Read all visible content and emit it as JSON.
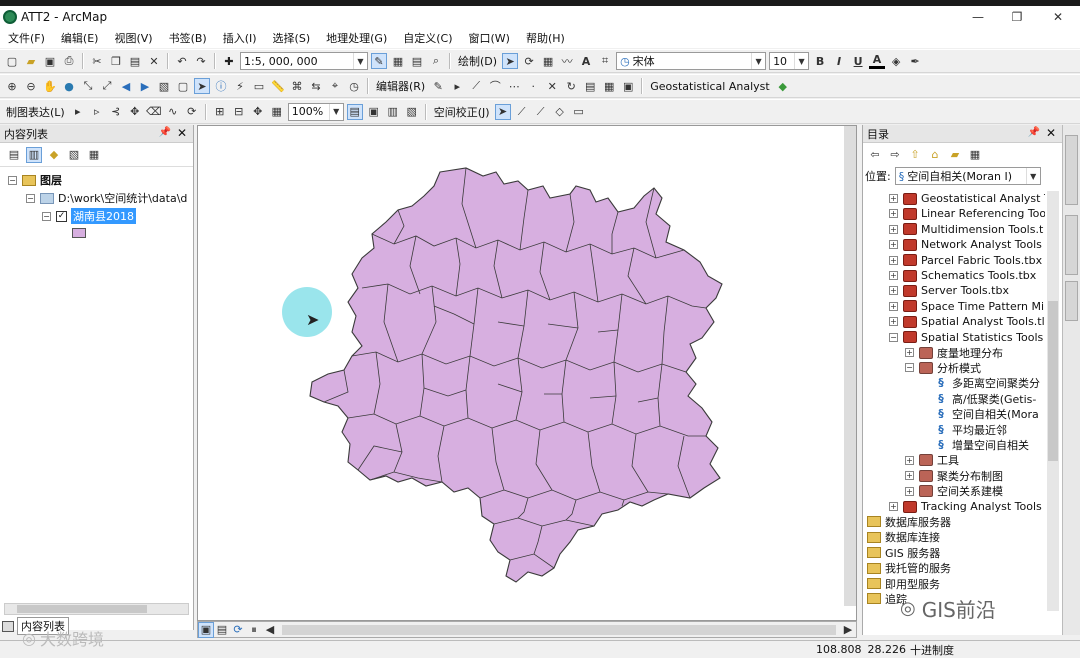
{
  "window": {
    "title": "ATT2 - ArcMap",
    "min": "—",
    "restore": "❐",
    "close": "✕"
  },
  "menus": [
    "文件(F)",
    "编辑(E)",
    "视图(V)",
    "书签(B)",
    "插入(I)",
    "选择(S)",
    "地理处理(G)",
    "自定义(C)",
    "窗口(W)",
    "帮助(H)"
  ],
  "toolbar1": {
    "scale": "1:5, 000, 000",
    "draw": "绘制(D)",
    "font": "宋体",
    "font_size": "10",
    "bold": "B",
    "italic": "I",
    "underline": "U",
    "font_color": "A"
  },
  "toolbar2": {
    "editor": "编辑器(R)",
    "geostat": "Geostatistical Analyst"
  },
  "toolbar3": {
    "layout": "制图表达(L)",
    "zoom": "100%",
    "georef": "空间校正(J)"
  },
  "toc": {
    "title": "内容列表",
    "root": "图层",
    "path": "D:\\work\\空间统计\\data\\d",
    "layer": "湖南县2018",
    "bottom_tab": "内容列表"
  },
  "catalog": {
    "title": "目录",
    "location_label": "位置:",
    "location_value": "空间自相关(Moran I)",
    "items": [
      {
        "label": "Geostatistical Analyst T",
        "kind": "tbx",
        "indent": 0,
        "expand": "+"
      },
      {
        "label": "Linear Referencing Too",
        "kind": "tbx",
        "indent": 0,
        "expand": "+"
      },
      {
        "label": "Multidimension Tools.t",
        "kind": "tbx",
        "indent": 0,
        "expand": "+"
      },
      {
        "label": "Network Analyst Tools",
        "kind": "tbx",
        "indent": 0,
        "expand": "+"
      },
      {
        "label": "Parcel Fabric Tools.tbx",
        "kind": "tbx",
        "indent": 0,
        "expand": "+"
      },
      {
        "label": "Schematics Tools.tbx",
        "kind": "tbx",
        "indent": 0,
        "expand": "+"
      },
      {
        "label": "Server Tools.tbx",
        "kind": "tbx",
        "indent": 0,
        "expand": "+"
      },
      {
        "label": "Space Time Pattern Mi",
        "kind": "tbx",
        "indent": 0,
        "expand": "+"
      },
      {
        "label": "Spatial Analyst Tools.tl",
        "kind": "tbx",
        "indent": 0,
        "expand": "+"
      },
      {
        "label": "Spatial Statistics Tools",
        "kind": "tbx",
        "indent": 0,
        "expand": "−"
      },
      {
        "label": "度量地理分布",
        "kind": "tset",
        "indent": 1,
        "expand": "+"
      },
      {
        "label": "分析模式",
        "kind": "tset",
        "indent": 1,
        "expand": "−"
      },
      {
        "label": "多距离空间聚类分",
        "kind": "tool",
        "indent": 2,
        "expand": ""
      },
      {
        "label": "高/低聚类(Getis-",
        "kind": "tool",
        "indent": 2,
        "expand": ""
      },
      {
        "label": "空间自相关(Mora",
        "kind": "tool",
        "indent": 2,
        "expand": ""
      },
      {
        "label": "平均最近邻",
        "kind": "tool",
        "indent": 2,
        "expand": ""
      },
      {
        "label": "增量空间自相关",
        "kind": "tool",
        "indent": 2,
        "expand": ""
      },
      {
        "label": "工具",
        "kind": "tset",
        "indent": 1,
        "expand": "+"
      },
      {
        "label": "聚类分布制图",
        "kind": "tset",
        "indent": 1,
        "expand": "+"
      },
      {
        "label": "空间关系建模",
        "kind": "tset",
        "indent": 1,
        "expand": "+"
      },
      {
        "label": "Tracking Analyst Tools",
        "kind": "tbx",
        "indent": 0,
        "expand": "+"
      },
      {
        "label": "数据库服务器",
        "kind": "folder",
        "indent": -1,
        "expand": ""
      },
      {
        "label": "数据库连接",
        "kind": "folder",
        "indent": -1,
        "expand": ""
      },
      {
        "label": "GIS 服务器",
        "kind": "folder",
        "indent": -1,
        "expand": ""
      },
      {
        "label": "我托管的服务",
        "kind": "folder",
        "indent": -1,
        "expand": ""
      },
      {
        "label": "即用型服务",
        "kind": "folder",
        "indent": -1,
        "expand": ""
      },
      {
        "label": "追踪",
        "kind": "folder",
        "indent": -1,
        "expand": ""
      }
    ]
  },
  "status": {
    "x": "108.808",
    "y": "28.226",
    "units": "十进制度"
  },
  "watermarks": {
    "right": "GIS前沿",
    "left": "大数跨境"
  },
  "colors": {
    "polygon_fill": "#d7afe0",
    "polygon_stroke": "#3a3a3a",
    "selection": "#3399ff"
  }
}
